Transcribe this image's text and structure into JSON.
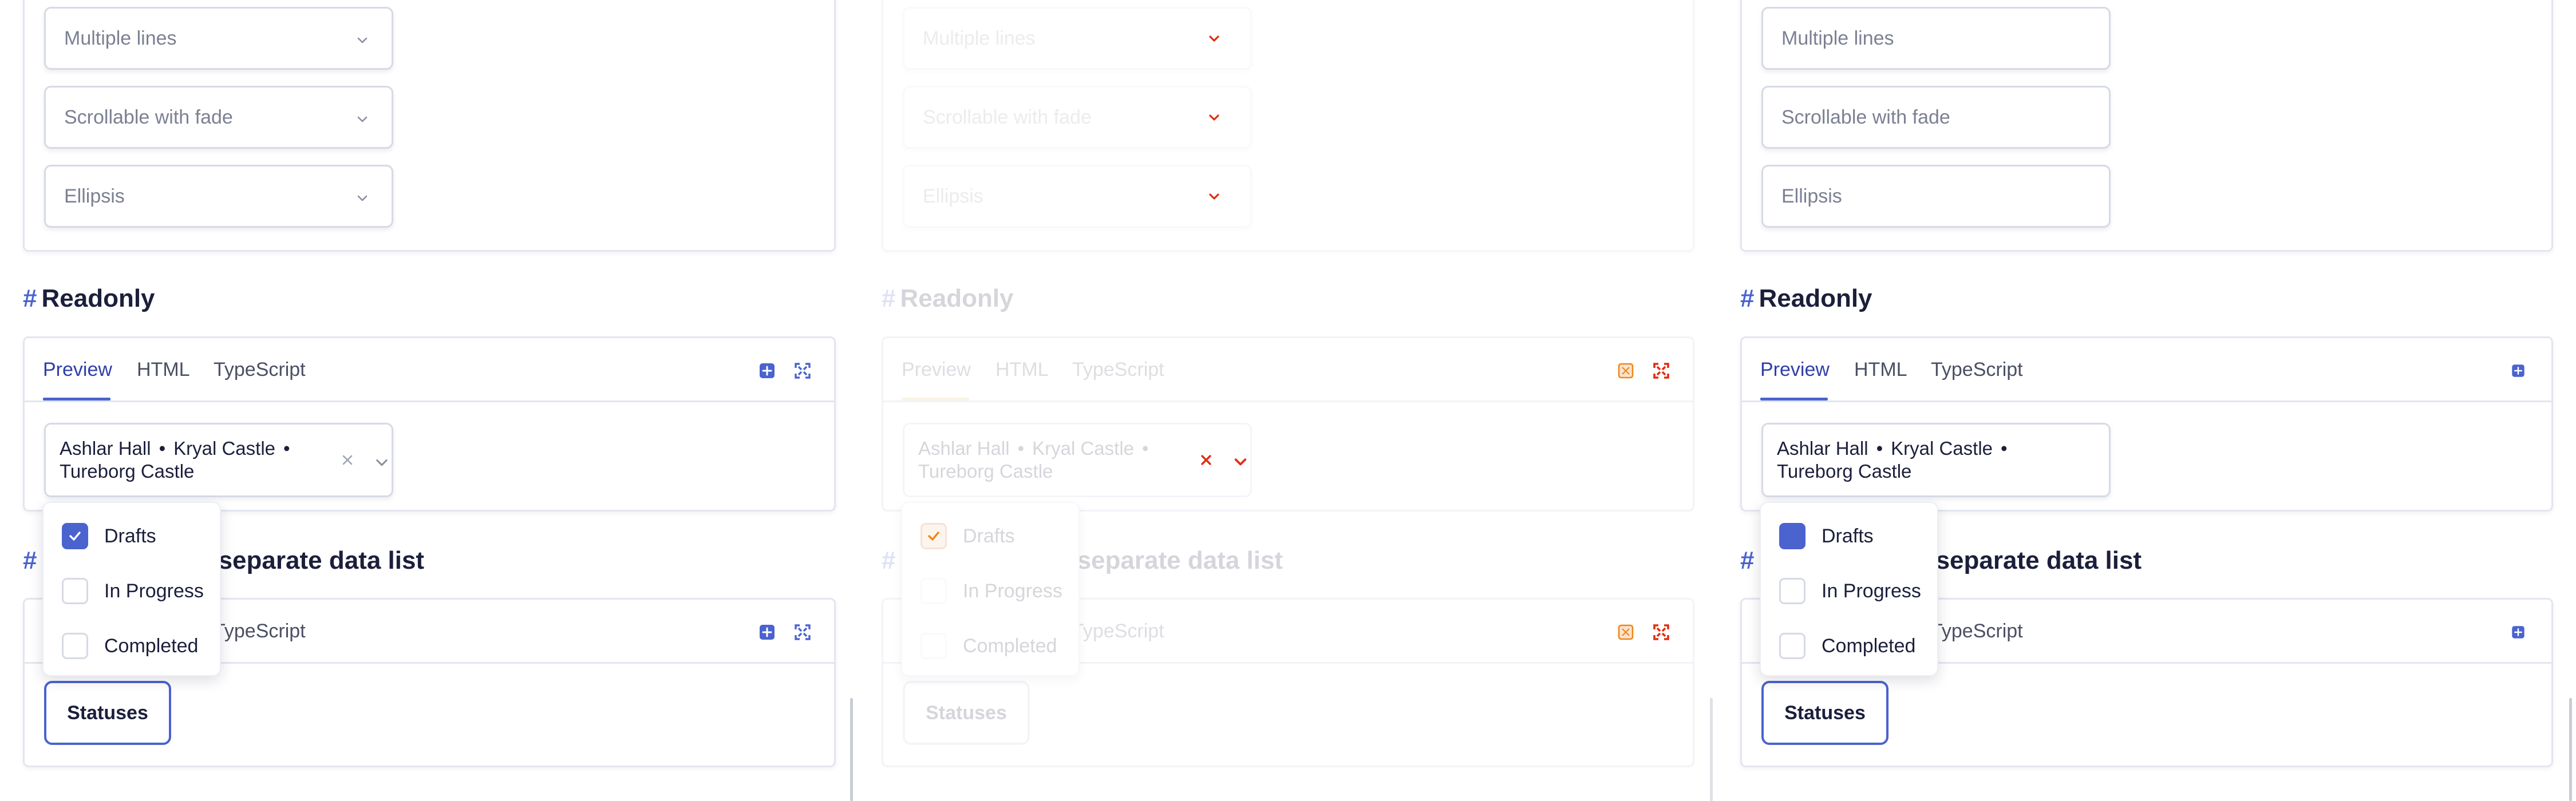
{
  "colors": {
    "accent": "#4a63cf",
    "error": "#e22d10",
    "warning": "#f0871a",
    "text": "#1b1f3b",
    "muted": "#7b8092"
  },
  "panels": [
    {
      "variant": "default",
      "selects": [
        "Multiple lines",
        "Scrollable with fade",
        "Ellipsis"
      ],
      "readonly": {
        "heading_hash": "#",
        "heading": "Readonly",
        "tabs": [
          "Preview",
          "HTML",
          "TypeScript"
        ],
        "icons": [
          "open-in-editor-icon",
          "fullscreen-icon"
        ],
        "value_items": [
          "Ashlar Hall",
          "Kryal Castle",
          "Tureborg Castle"
        ],
        "separator": "•"
      },
      "datalist": {
        "heading_hash": "#",
        "heading_visible": "n separate data list",
        "tab_visible": "TypeScript",
        "button": "Statuses",
        "options": [
          {
            "label": "Drafts",
            "checked": true
          },
          {
            "label": "In Progress",
            "checked": false
          },
          {
            "label": "Completed",
            "checked": false
          }
        ]
      }
    },
    {
      "variant": "disabled-error",
      "selects": [
        "Multiple lines",
        "Scrollable with fade",
        "Ellipsis"
      ],
      "readonly": {
        "heading_hash": "#",
        "heading": "Readonly",
        "tabs": [
          "Preview",
          "HTML",
          "TypeScript"
        ],
        "icons": [
          "open-in-editor-icon",
          "fullscreen-icon"
        ],
        "value_items": [
          "Ashlar Hall",
          "Kryal Castle",
          "Tureborg Castle"
        ],
        "separator": "•"
      },
      "datalist": {
        "heading_hash": "#",
        "heading_visible": "n separate data list",
        "tab_visible": "TypeScript",
        "button": "Statuses",
        "options": [
          {
            "label": "Drafts",
            "checked": true
          },
          {
            "label": "In Progress",
            "checked": false
          },
          {
            "label": "Completed",
            "checked": false
          }
        ]
      }
    },
    {
      "variant": "plain",
      "selects": [
        "Multiple lines",
        "Scrollable with fade",
        "Ellipsis"
      ],
      "readonly": {
        "heading_hash": "#",
        "heading": "Readonly",
        "tabs": [
          "Preview",
          "HTML",
          "TypeScript"
        ],
        "icons": [
          "open-in-editor-icon"
        ],
        "value_items": [
          "Ashlar Hall",
          "Kryal Castle",
          "Tureborg Castle"
        ],
        "separator": "•"
      },
      "datalist": {
        "heading_hash": "#",
        "heading_visible": "n separate data list",
        "tab_visible": "TypeScript",
        "button": "Statuses",
        "options": [
          {
            "label": "Drafts",
            "checked": true
          },
          {
            "label": "In Progress",
            "checked": false
          },
          {
            "label": "Completed",
            "checked": false
          }
        ]
      }
    }
  ]
}
